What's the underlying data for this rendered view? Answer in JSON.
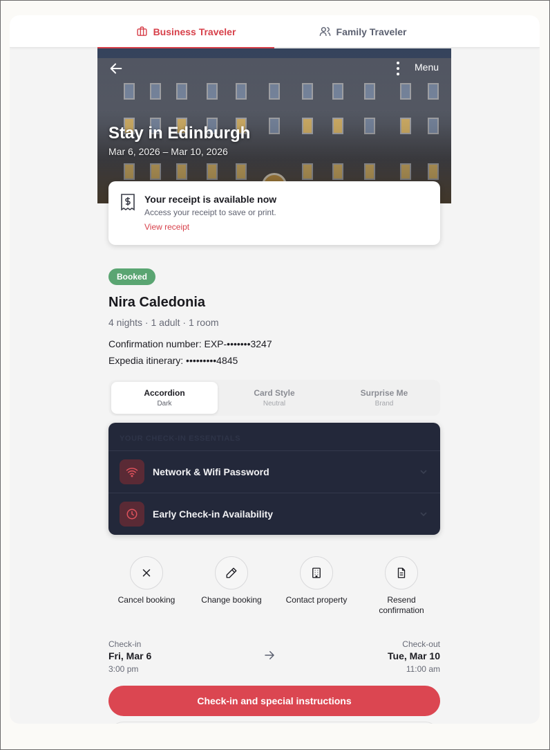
{
  "tabs": [
    {
      "label": "Business Traveler",
      "icon": "briefcase-icon",
      "active": true
    },
    {
      "label": "Family Traveler",
      "icon": "users-icon",
      "active": false
    }
  ],
  "hero": {
    "menu_label": "Menu",
    "title": "Stay in Edinburgh",
    "dates": "Mar 6, 2026 – Mar 10, 2026"
  },
  "receipt": {
    "title": "Your receipt is available now",
    "subtitle": "Access your receipt to save or print.",
    "link": "View receipt",
    "icon": "receipt-icon"
  },
  "booking": {
    "status": "Booked",
    "hotel_name": "Nira Caledonia",
    "summary": "4 nights · 1 adult · 1 room",
    "confirmation": "Confirmation number: EXP-•••••••3247",
    "itinerary": "Expedia itinerary: •••••••••4845"
  },
  "styles": [
    {
      "name": "Accordion",
      "sub": "Dark",
      "active": true
    },
    {
      "name": "Card Style",
      "sub": "Neutral",
      "active": false
    },
    {
      "name": "Surprise Me",
      "sub": "Brand",
      "active": false
    }
  ],
  "essentials": {
    "heading": "YOUR CHECK-IN ESSENTIALS",
    "items": [
      {
        "label": "Network & Wifi Password",
        "icon": "wifi-icon"
      },
      {
        "label": "Early Check-in Availability",
        "icon": "clock-icon"
      }
    ]
  },
  "actions": [
    {
      "label": "Cancel booking",
      "icon": "close-icon"
    },
    {
      "label": "Change booking",
      "icon": "pencil-icon"
    },
    {
      "label": "Contact property",
      "icon": "building-icon"
    },
    {
      "label": "Resend confirmation",
      "icon": "document-icon"
    }
  ],
  "checkin": {
    "label": "Check-in",
    "date": "Fri, Mar 6",
    "time": "3:00 pm"
  },
  "checkout": {
    "label": "Check-out",
    "date": "Tue, Mar 10",
    "time": "11:00 am"
  },
  "cta": {
    "label": "Check-in and special instructions"
  },
  "colors": {
    "accent": "#d7404a",
    "success": "#5aa572",
    "dark_panel": "#23283a"
  }
}
